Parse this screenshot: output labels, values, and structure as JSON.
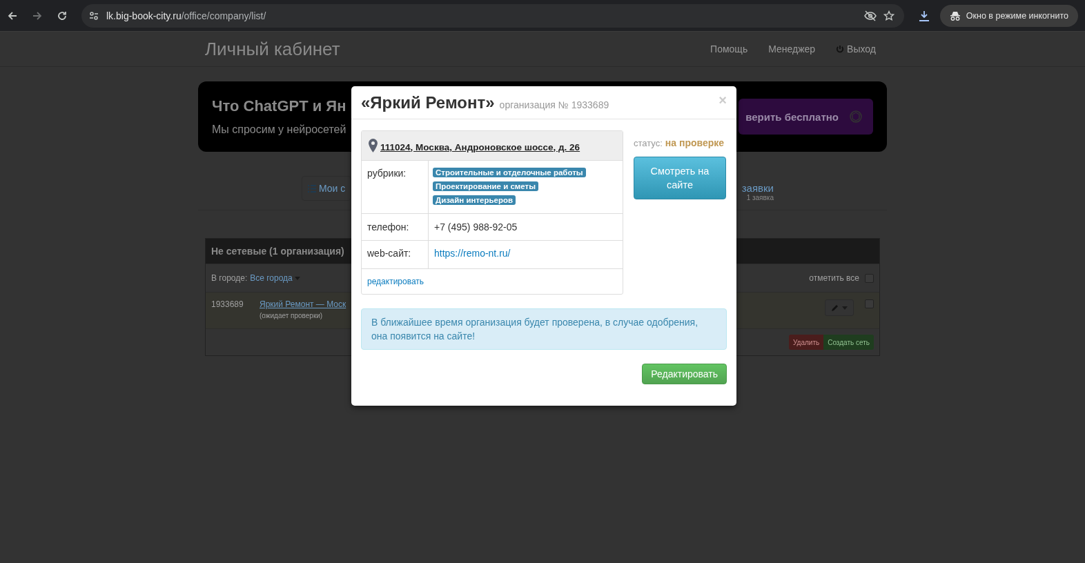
{
  "browser": {
    "url_host": "lk.big-book-city.ru",
    "url_path": "/office/company/list/",
    "incognito": "Окно в режиме инкогнито"
  },
  "header": {
    "title": "Личный кабинет",
    "nav": [
      {
        "label": "Помощь",
        "kind": "plain"
      },
      {
        "label": "Менеджер",
        "kind": "plain"
      },
      {
        "label": "Выход",
        "kind": "logout"
      }
    ]
  },
  "banner": {
    "title": "Что ChatGPT и Ян",
    "subtitle": "Мы спросим у нейросетей",
    "button": "верить бесплатно"
  },
  "tabs": {
    "left": {
      "label": "Мои с"
    },
    "right": {
      "label": "заявки",
      "count": "1 заявка"
    }
  },
  "panel": {
    "title": "Не сетевые (1 организация)",
    "city_label": "В городе:",
    "city_value": "Все города",
    "check_all": {
      "label": "отметить все",
      "checked": false
    },
    "rows": [
      {
        "id": "1933689",
        "name": "Яркий Ремонт — Моск",
        "note": "(ожидает проверки)",
        "checked": false
      }
    ],
    "buttons": [
      {
        "label": "Удалить",
        "kind": "danger"
      },
      {
        "label": "Создать сеть",
        "kind": "success"
      }
    ]
  },
  "modal": {
    "title": "«Яркий Ремонт»",
    "subtitle": "организация № 1933689",
    "close": "×",
    "address": "111024, Москва, Андроновское шоссе, д. 26",
    "fields": [
      {
        "label": "рубрики:",
        "kind": "tags",
        "tags": [
          "Строительные и отделочные работы",
          "Проектирование и сметы",
          "Дизайн интерьеров"
        ]
      },
      {
        "label": "телефон:",
        "kind": "text",
        "value": "+7 (495) 988-92-05"
      },
      {
        "label": "web-сайт:",
        "kind": "link",
        "value": "https://remo-nt.ru/"
      }
    ],
    "edit_link": "редактировать",
    "status_label": "статус:",
    "status_value": "на проверке",
    "view_button": "Смотреть на сайте",
    "notice": "В ближайшее время организация будет проверена, в случае одобрения, она появится на сайте!",
    "edit_button": "Редактировать"
  }
}
